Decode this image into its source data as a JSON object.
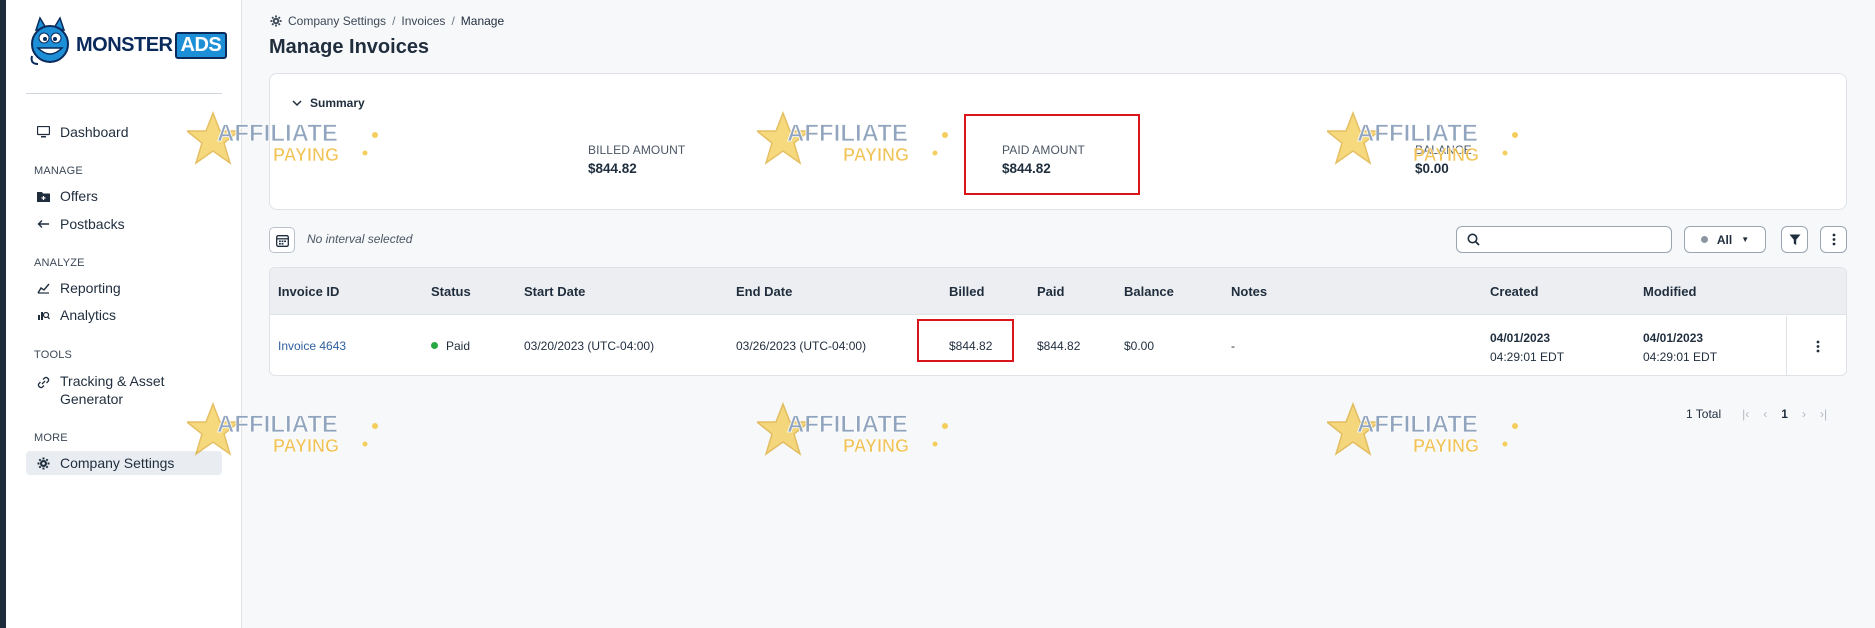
{
  "logo": {
    "brand_main": "MONSTER",
    "brand_accent": "ADS"
  },
  "sidebar": {
    "dashboard": "Dashboard",
    "sections": {
      "manage": "MANAGE",
      "analyze": "ANALYZE",
      "tools": "TOOLS",
      "more": "MORE"
    },
    "items": {
      "offers": "Offers",
      "postbacks": "Postbacks",
      "reporting": "Reporting",
      "analytics": "Analytics",
      "tracking_line1": "Tracking & Asset",
      "tracking_line2": "Generator",
      "company_settings": "Company Settings"
    }
  },
  "breadcrumb": {
    "root": "Company Settings",
    "sep": "/",
    "middle": "Invoices",
    "current": "Manage"
  },
  "page_title": "Manage Invoices",
  "summary": {
    "toggle_label": "Summary",
    "billed_label": "BILLED AMOUNT",
    "billed_value": "$844.82",
    "paid_label": "PAID AMOUNT",
    "paid_value": "$844.82",
    "balance_label": "BALANCE",
    "balance_value": "$0.00"
  },
  "toolbar": {
    "interval_text": "No interval selected",
    "search_value": "",
    "filter_all_label": "All"
  },
  "table": {
    "headers": {
      "invoice_id": "Invoice ID",
      "status": "Status",
      "start_date": "Start Date",
      "end_date": "End Date",
      "billed": "Billed",
      "paid": "Paid",
      "balance": "Balance",
      "notes": "Notes",
      "created": "Created",
      "modified": "Modified"
    },
    "rows": [
      {
        "invoice_id": "Invoice 4643",
        "status": "Paid",
        "start_date": "03/20/2023 (UTC-04:00)",
        "end_date": "03/26/2023 (UTC-04:00)",
        "billed": "$844.82",
        "paid": "$844.82",
        "balance": "$0.00",
        "notes": "-",
        "created_date": "04/01/2023",
        "created_time": "04:29:01 EDT",
        "modified_date": "04/01/2023",
        "modified_time": "04:29:01 EDT"
      }
    ]
  },
  "pagination": {
    "total": "1 Total",
    "first": "|‹",
    "prev": "‹",
    "current": "1",
    "next": "›",
    "last": "›|"
  },
  "watermark": {
    "word1": "AFFILIATE",
    "word2": "PAYING"
  },
  "colors": {
    "accent_link": "#2f5f9e",
    "status_paid": "#28a745",
    "highlight_box": "#d9151b",
    "sidebar_active": "#e9edf2"
  }
}
